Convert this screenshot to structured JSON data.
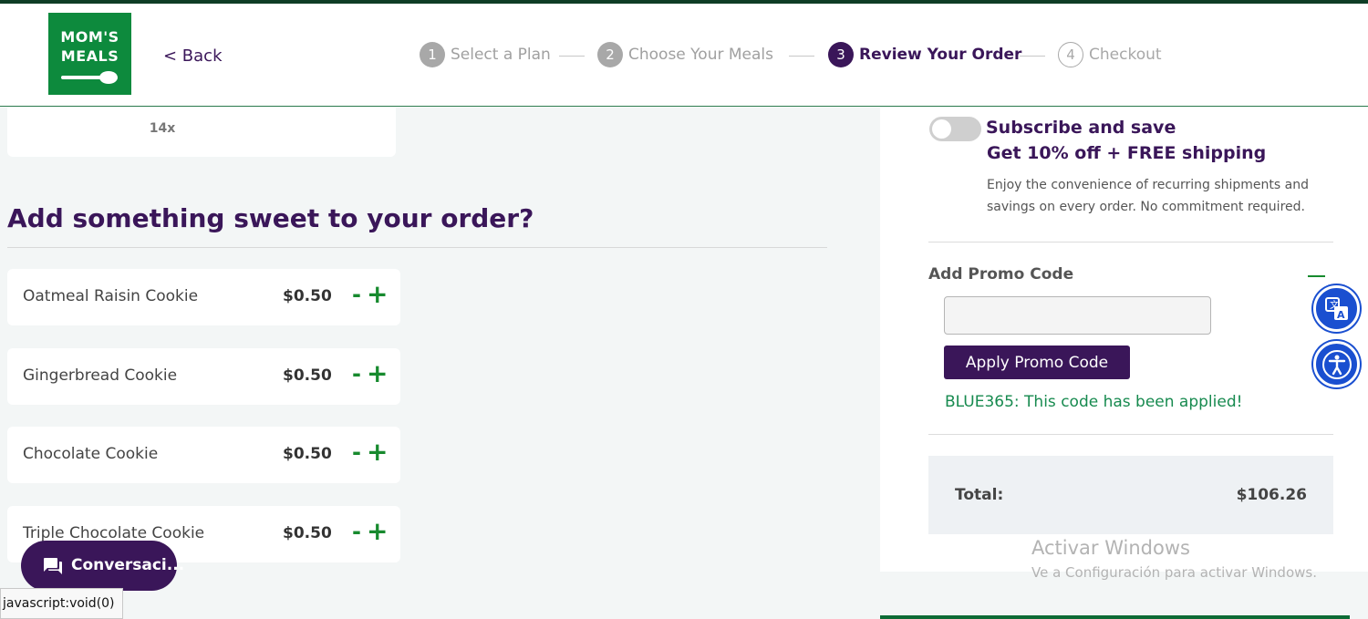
{
  "header": {
    "logo_line1": "MOM'S",
    "logo_line2": "MEALS",
    "back_label": "< Back",
    "steps": [
      {
        "num": "1",
        "label": "Select a Plan",
        "state": "done"
      },
      {
        "num": "2",
        "label": "Choose Your Meals",
        "state": "done"
      },
      {
        "num": "3",
        "label": "Review Your Order",
        "state": "active"
      },
      {
        "num": "4",
        "label": "Checkout",
        "state": "todo"
      }
    ]
  },
  "order": {
    "quantity_label": "14x"
  },
  "sweets": {
    "title": "Add something sweet to your order?",
    "items": [
      {
        "name": "Oatmeal Raisin Cookie",
        "price": "$0.50",
        "minus": "-",
        "plus": "+"
      },
      {
        "name": "Gingerbread Cookie",
        "price": "$0.50",
        "minus": "-",
        "plus": "+"
      },
      {
        "name": "Chocolate Cookie",
        "price": "$0.50",
        "minus": "-",
        "plus": "+"
      },
      {
        "name": "Triple Chocolate Cookie",
        "price": "$0.50",
        "minus": "-",
        "plus": "+"
      }
    ]
  },
  "subscription": {
    "title": "Subscribe and save",
    "offer": "Get 10% off + FREE shipping",
    "description": "Enjoy the convenience of recurring shipments and savings on every order. No commitment required.",
    "toggle_on": false
  },
  "promo": {
    "label": "Add Promo Code",
    "input_value": "",
    "apply_label": "Apply Promo Code",
    "status": "BLUE365: This code has been applied!"
  },
  "total": {
    "label": "Total:",
    "value": "$106.26"
  },
  "chat": {
    "label": "Conversaci..."
  },
  "status_bar": {
    "url": "javascript:void(0)"
  },
  "watermark": {
    "line1": "Activar Windows",
    "line2": "Ve a Configuración para activar Windows."
  },
  "icons": {
    "translate": "translate-icon",
    "accessibility": "accessibility-icon",
    "chat": "chat-icon"
  },
  "colors": {
    "brand_purple": "#3a1659",
    "brand_green": "#0d8a3d",
    "accent_blue": "#1a4fd0"
  }
}
